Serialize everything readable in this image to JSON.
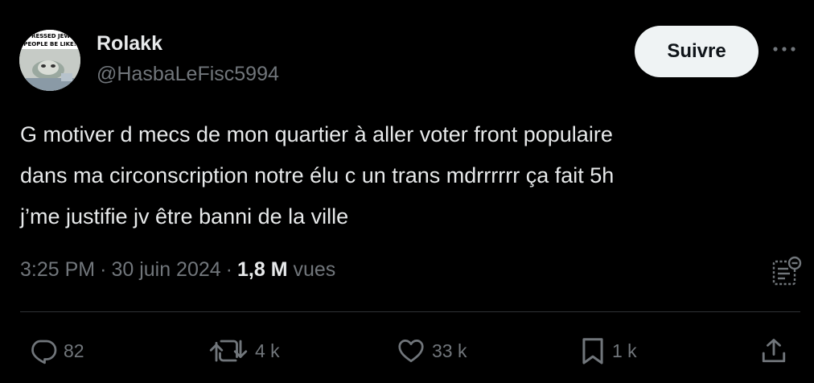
{
  "author": {
    "display_name": "Rolakk",
    "handle": "@HasbaLeFisc5994",
    "avatar_caption_lines": [
      "EPRESSED JEWIS",
      "PEOPLE BE LIKE:"
    ]
  },
  "follow_button": {
    "label": "Suivre"
  },
  "more_button": {
    "icon": "more-horizontal-icon"
  },
  "tweet": {
    "lines": [
      "G motiver d mecs de mon quartier à aller voter front populaire",
      "dans ma circonscription notre élu c un trans mdrrrrrr ça fait 5h",
      "j’me justifie jv être banni de la ville"
    ]
  },
  "meta": {
    "time": "3:25 PM",
    "date": "30 juin 2024",
    "separator": "·",
    "views_count": "1,8 M",
    "views_label": "vues"
  },
  "actions": {
    "reply": {
      "count": "82",
      "icon": "reply-icon"
    },
    "repost": {
      "count": "4 k",
      "icon": "repost-icon"
    },
    "like": {
      "count": "33 k",
      "icon": "like-icon"
    },
    "bookmark": {
      "count": "1 k",
      "icon": "bookmark-icon"
    },
    "share": {
      "icon": "share-icon"
    }
  },
  "colors": {
    "background": "#000000",
    "primary_text": "#e7e9ea",
    "secondary_text": "#71767b",
    "divider": "#2f3336",
    "follow_button_bg": "#eff3f4"
  }
}
